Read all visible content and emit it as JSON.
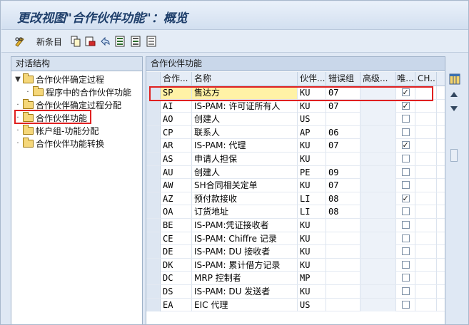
{
  "window": {
    "title": "更改视图\"合作伙伴功能\"：概览"
  },
  "toolbar": {
    "new_entry_label": "新条目",
    "icons": [
      "pencil-glasses-icon",
      "copy-icon",
      "save-delete-icon",
      "undo-icon",
      "select-all-icon",
      "select-block-icon",
      "deselect-all-icon"
    ]
  },
  "left_panel": {
    "header": "对话结构",
    "items": [
      {
        "label": "合作伙伴确定过程",
        "level": 0,
        "bullet": "▼"
      },
      {
        "label": "程序中的合作伙伴功能",
        "level": 1,
        "bullet": "·"
      },
      {
        "label": "合作伙伴确定过程分配",
        "level": 0,
        "bullet": "·"
      },
      {
        "label": "合作伙伴功能",
        "level": 0,
        "bullet": "·",
        "selected": true
      },
      {
        "label": "帐户组-功能分配",
        "level": 0,
        "bullet": "·"
      },
      {
        "label": "合作伙伴功能转换",
        "level": 0,
        "bullet": "·"
      }
    ]
  },
  "right_panel": {
    "header": "合作伙伴功能",
    "columns": [
      "合作...",
      "名称",
      "伙伴...",
      "错误组",
      "高级...",
      "唯...",
      "CH..."
    ],
    "rows": [
      {
        "code": "SP",
        "name": "售达方",
        "type": "KU",
        "err": "07",
        "unique": true
      },
      {
        "code": "AI",
        "name": "IS-PAM: 许可证所有人",
        "type": "KU",
        "err": "07",
        "unique": true
      },
      {
        "code": "AO",
        "name": "创建人",
        "type": "US",
        "err": "",
        "unique": false
      },
      {
        "code": "CP",
        "name": "联系人",
        "type": "AP",
        "err": "06",
        "unique": false
      },
      {
        "code": "AR",
        "name": "IS-PAM: 代理",
        "type": "KU",
        "err": "07",
        "unique": true
      },
      {
        "code": "AS",
        "name": "申请人担保",
        "type": "KU",
        "err": "",
        "unique": false
      },
      {
        "code": "AU",
        "name": "创建人",
        "type": "PE",
        "err": "09",
        "unique": false
      },
      {
        "code": "AW",
        "name": "SH合同相关定单",
        "type": "KU",
        "err": "07",
        "unique": false
      },
      {
        "code": "AZ",
        "name": "预付款接收",
        "type": "LI",
        "err": "08",
        "unique": true
      },
      {
        "code": "OA",
        "name": "订货地址",
        "type": "LI",
        "err": "08",
        "unique": false
      },
      {
        "code": "BE",
        "name": "IS-PAM:凭证接收者",
        "type": "KU",
        "err": "",
        "unique": false
      },
      {
        "code": "CE",
        "name": "IS-PAM: Chiffre 记录",
        "type": "KU",
        "err": "",
        "unique": false
      },
      {
        "code": "DE",
        "name": "IS-PAM: DU 接收者",
        "type": "KU",
        "err": "",
        "unique": false
      },
      {
        "code": "DK",
        "name": "IS-PAM: 累计借方记录",
        "type": "KU",
        "err": "",
        "unique": false
      },
      {
        "code": "DC",
        "name": "MRP 控制者",
        "type": "MP",
        "err": "",
        "unique": false
      },
      {
        "code": "DS",
        "name": "IS-PAM: DU 发送者",
        "type": "KU",
        "err": "",
        "unique": false
      },
      {
        "code": "EA",
        "name": "EIC 代理",
        "type": "US",
        "err": "",
        "unique": false
      }
    ]
  },
  "scrollbar": {
    "table_settings_icon": "table-settings-icon"
  }
}
